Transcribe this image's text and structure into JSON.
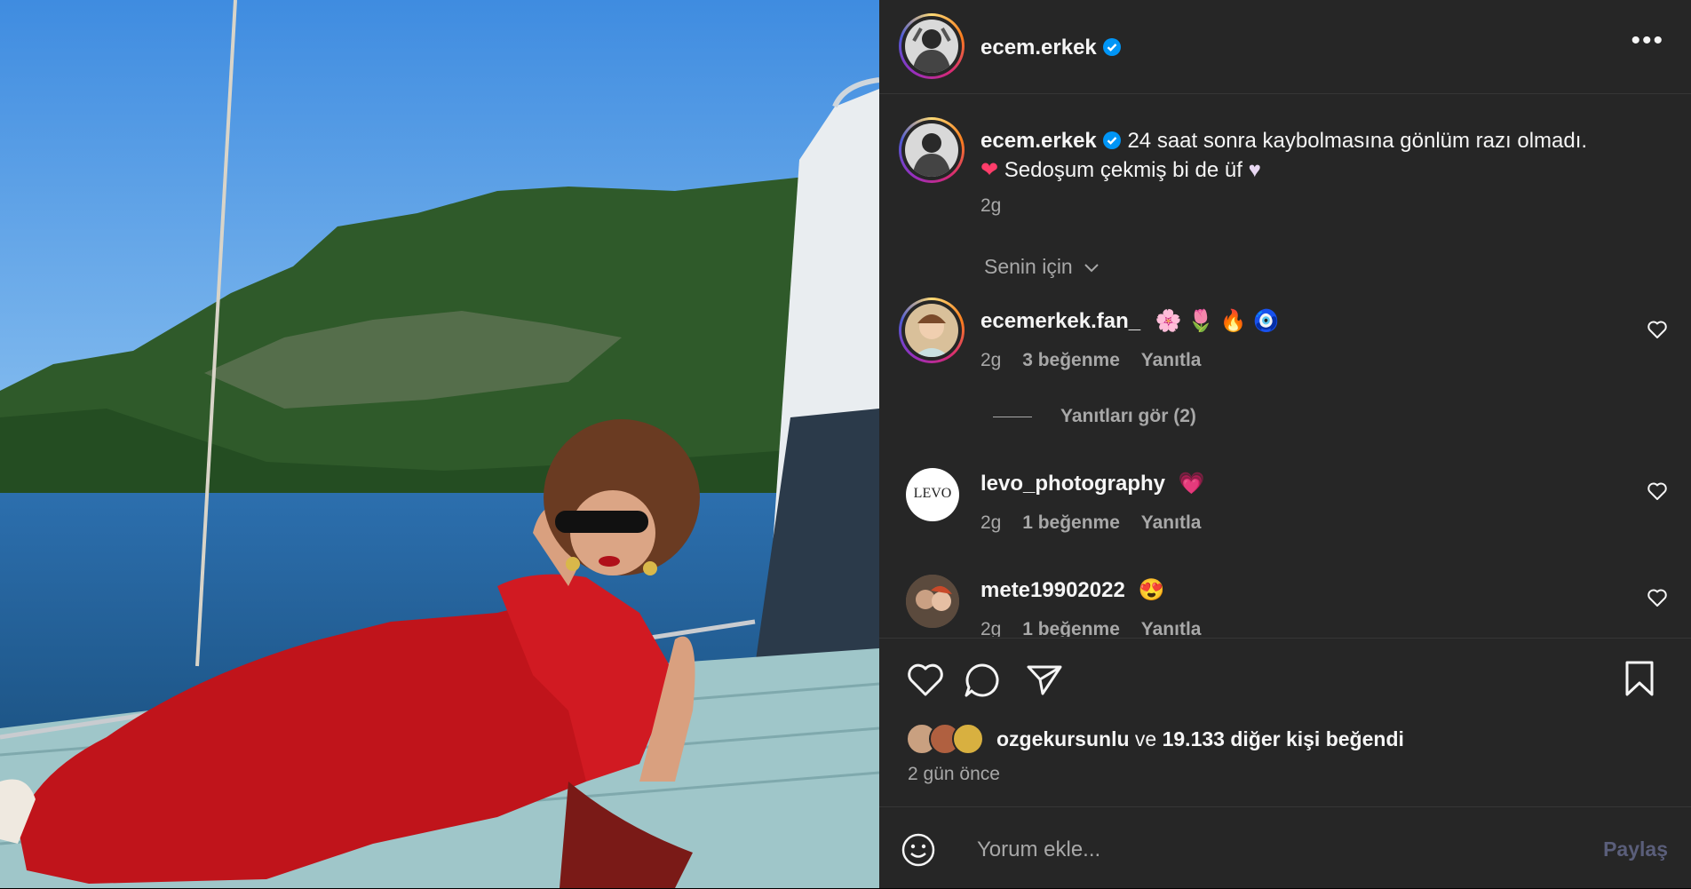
{
  "post": {
    "username": "ecem.erkek",
    "caption": "24 saat sonra kaybolmasına gönlüm razı olmadı.",
    "caption_line2": "Sedoşum çekmiş bi de üf",
    "time": "2g",
    "more_label": "•••"
  },
  "sort_label": "Senin için",
  "comments": [
    {
      "username": "ecemerkek.fan_",
      "text": "🌸 🌷 🔥 🧿",
      "time": "2g",
      "likes": "3 beğenme",
      "reply": "Yanıtla"
    },
    {
      "username": "levo_photography",
      "text": "💗",
      "time": "2g",
      "likes": "1 beğenme",
      "reply": "Yanıtla",
      "avatar_text": "LEVO"
    },
    {
      "username": "mete19902022",
      "text": "😍",
      "time": "2g",
      "likes": "1 beğenme",
      "reply": "Yanıtla"
    }
  ],
  "view_replies": "Yanıtları gör (2)",
  "likes_summary": {
    "user": "ozgekursunlu",
    "connector": " ve ",
    "rest": "19.133 diğer kişi",
    "suffix": " beğendi"
  },
  "posted_ago": "2 gün önce",
  "comment_input": {
    "placeholder": "Yorum ekle...",
    "share_label": "Paylaş"
  },
  "colors": {
    "panel_bg": "#262626",
    "verified": "#0095f6",
    "secondary_text": "#a8a8a8"
  }
}
